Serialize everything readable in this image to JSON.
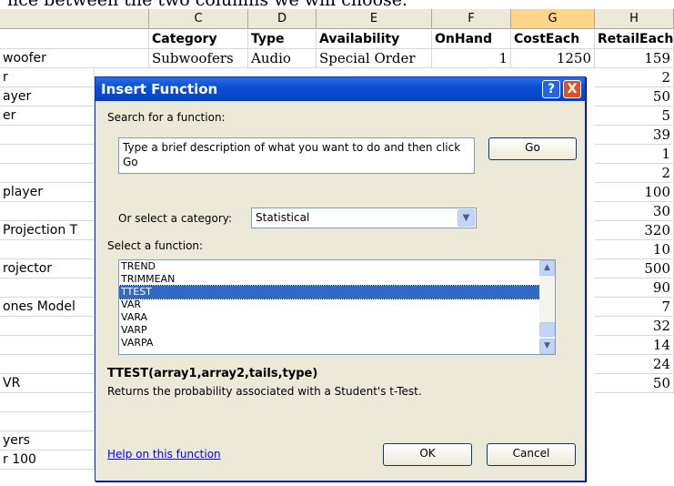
{
  "caption": "nce between the two columns we will choose.",
  "sheet": {
    "columns": [
      "C",
      "D",
      "E",
      "F",
      "G",
      "H"
    ],
    "headers": [
      "Category",
      "Type",
      "Availability",
      "OnHand",
      "CostEach",
      "RetailEach"
    ],
    "first_row": [
      "Subwoofers",
      "Audio",
      "Special Order",
      "1",
      "1250",
      "159"
    ],
    "colB_cells": [
      "woofer",
      "r",
      "ayer",
      "er",
      "",
      "",
      "",
      "player",
      "",
      "Projection T",
      "",
      "rojector",
      "",
      "ones Model",
      "",
      "",
      "",
      "VR",
      "",
      "",
      "yers",
      "r 100"
    ],
    "colH_values": [
      "159",
      "2",
      "50",
      "5",
      "39",
      "1",
      "2",
      "100",
      "30",
      "320",
      "10",
      "500",
      "90",
      "7",
      "32",
      "14",
      "24",
      "50"
    ]
  },
  "dialog": {
    "title": "Insert Function",
    "help_glyph": "?",
    "close_glyph": "X",
    "search_label": "Search for a function:",
    "search_text": "Type a brief description of what you want to do and then click Go",
    "go_button": "Go",
    "category_label": "Or select a category:",
    "category_value": "Statistical",
    "select_label": "Select a function:",
    "functions": [
      "TREND",
      "TRIMMEAN",
      "TTEST",
      "VAR",
      "VARA",
      "VARP",
      "VARPA"
    ],
    "selected_function": "TTEST",
    "signature": "TTEST(array1,array2,tails,type)",
    "description": "Returns the probability associated with a Student's t-Test.",
    "help_link": "Help on this function",
    "ok_button": "OK",
    "cancel_button": "Cancel"
  }
}
